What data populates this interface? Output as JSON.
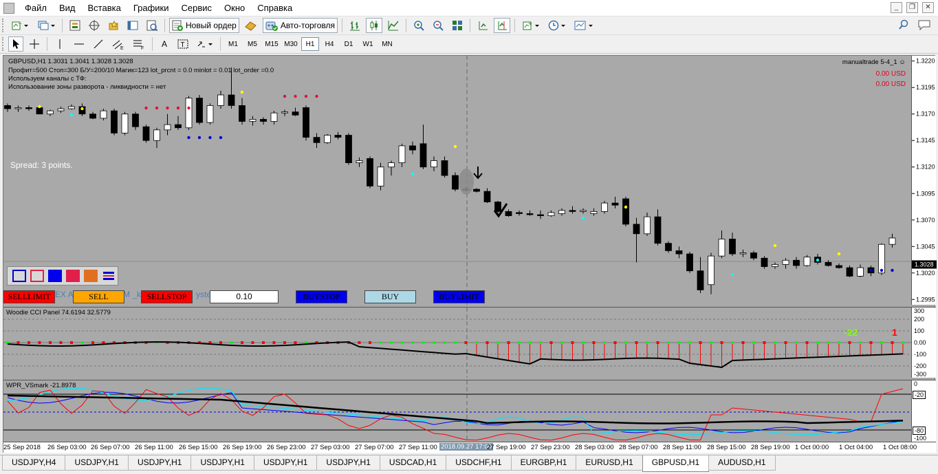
{
  "menu": {
    "items": [
      "Файл",
      "Вид",
      "Вставка",
      "Графики",
      "Сервис",
      "Окно",
      "Справка"
    ]
  },
  "toolbar": {
    "new_order": "Новый ордер",
    "autotrade": "Авто-торговля",
    "timeframes": [
      "M1",
      "M5",
      "M15",
      "M30",
      "H1",
      "H4",
      "D1",
      "W1",
      "MN"
    ],
    "active_timeframe": "H1"
  },
  "chart": {
    "header": "GBPUSD,H1  1.3031 1.3041 1.3028 1.3028",
    "info_lines": [
      "Профит=500  Стоп=300  Б/У=200/10  Магик=123 lot_prcnt = 0.0 minlot = 0.01 lot_order =0.0",
      "Используем каналы с ТФ:",
      "Использование зоны разворота - ликвидности = нет"
    ],
    "spread": "Spread: 3 points.",
    "account": "manualtrade 5-4_1",
    "pnl": [
      "0.00 USD",
      "0.00 USD"
    ],
    "price_labels": [
      "1.3220",
      "1.3195",
      "1.3170",
      "1.3145",
      "1.3120",
      "1.3095",
      "1.3070",
      "1.3045",
      "1.3020",
      "1.2995"
    ],
    "current_price": "1.3028",
    "palette_colors": [
      "#0000cc",
      "#e0204a",
      "#0000ee",
      "#e0204a",
      "#e07020",
      "#0000cc"
    ],
    "order_buttons": {
      "selllimit": "SELLLIMIT",
      "sell": "SELL",
      "sellstop": "SELLSTOP",
      "lot": "0.10",
      "buystop": "BUYSTOP",
      "buy": "BUY",
      "buylimit": "BUYLIMIT"
    },
    "bg_fragments": [
      "EX Al",
      "M _k",
      "yster"
    ],
    "colors": {
      "bg": "#a9a9a9",
      "bear": "#000000",
      "bull": "#ffffff",
      "sell_dot": "#dc143c",
      "buy_dot": "#0000cd"
    }
  },
  "cci": {
    "title": "Woodie CCI Panel 74.6194 32.5779",
    "scale": [
      "300",
      "200",
      "100",
      "0.00",
      "-100",
      "-200",
      "-300"
    ],
    "value_left": "-22",
    "value_right": "1"
  },
  "wpr": {
    "title": "WPR_VSmark -21.8978",
    "scale": [
      "0",
      "-20",
      "-80",
      "-100"
    ]
  },
  "xaxis": {
    "labels": [
      "25 Sep 2018",
      "26 Sep 03:00",
      "26 Sep 07:00",
      "26 Sep 11:00",
      "26 Sep 15:00",
      "26 Sep 19:00",
      "26 Sep 23:00",
      "27 Sep 03:00",
      "27 Sep 07:00",
      "27 Sep 11:00",
      "2018.09.27 17:00",
      "27 Sep 19:00",
      "27 Sep 23:00",
      "28 Sep 03:00",
      "28 Sep 07:00",
      "28 Sep 11:00",
      "28 Sep 15:00",
      "28 Sep 19:00",
      "1 Oct 00:00",
      "1 Oct 04:00",
      "1 Oct 08:00"
    ]
  },
  "tabs": [
    "USDJPY,H4",
    "USDJPY,H1",
    "USDJPY,H1",
    "USDJPY,H1",
    "USDJPY,H1",
    "USDJPY,H1",
    "USDCAD,H1",
    "USDCHF,H1",
    "EURGBP,H1",
    "EURUSD,H1",
    "GBPUSD,H1",
    "AUDUSD,H1"
  ],
  "active_tab": "GBPUSD,H1",
  "candles": [
    [
      1.3178,
      1.318,
      1.3172,
      1.3175
    ],
    [
      1.3175,
      1.3178,
      1.3172,
      1.3176
    ],
    [
      1.3176,
      1.3178,
      1.3173,
      1.3175
    ],
    [
      1.3176,
      1.3178,
      1.317,
      1.317
    ],
    [
      1.317,
      1.3174,
      1.3168,
      1.3173
    ],
    [
      1.3173,
      1.3177,
      1.3171,
      1.3175
    ],
    [
      1.3175,
      1.3179,
      1.3174,
      1.3177
    ],
    [
      1.3177,
      1.318,
      1.3168,
      1.317
    ],
    [
      1.317,
      1.3172,
      1.3165,
      1.3166
    ],
    [
      1.3166,
      1.3175,
      1.3164,
      1.3173
    ],
    [
      1.3173,
      1.3175,
      1.315,
      1.3152
    ],
    [
      1.3152,
      1.3172,
      1.315,
      1.317
    ],
    [
      1.317,
      1.3172,
      1.3155,
      1.3158
    ],
    [
      1.3158,
      1.316,
      1.3143,
      1.3145
    ],
    [
      1.3145,
      1.3157,
      1.3138,
      1.3155
    ],
    [
      1.3155,
      1.317,
      1.315,
      1.316
    ],
    [
      1.316,
      1.3168,
      1.3155,
      1.3157
    ],
    [
      1.3157,
      1.3187,
      1.3155,
      1.3185
    ],
    [
      1.3185,
      1.3188,
      1.316,
      1.3162
    ],
    [
      1.3162,
      1.318,
      1.316,
      1.3178
    ],
    [
      1.3178,
      1.3192,
      1.3175,
      1.3188
    ],
    [
      1.3188,
      1.3214,
      1.3175,
      1.3178
    ],
    [
      1.3178,
      1.3185,
      1.316,
      1.3163
    ],
    [
      1.3163,
      1.3168,
      1.3159,
      1.3165
    ],
    [
      1.3165,
      1.3167,
      1.316,
      1.3163
    ],
    [
      1.3163,
      1.3173,
      1.316,
      1.3171
    ],
    [
      1.3171,
      1.3174,
      1.3168,
      1.3172
    ],
    [
      1.3172,
      1.3176,
      1.3168,
      1.3169
    ],
    [
      1.3176,
      1.3178,
      1.3145,
      1.3148
    ],
    [
      1.3148,
      1.3152,
      1.3138,
      1.3143
    ],
    [
      1.3143,
      1.3151,
      1.3142,
      1.315
    ],
    [
      1.315,
      1.3153,
      1.3146,
      1.3148
    ],
    [
      1.315,
      1.3152,
      1.3122,
      1.3124
    ],
    [
      1.3124,
      1.3129,
      1.312,
      1.3126
    ],
    [
      1.3128,
      1.313,
      1.31,
      1.3102
    ],
    [
      1.3102,
      1.3124,
      1.3098,
      1.312
    ],
    [
      1.312,
      1.3126,
      1.3112,
      1.3124
    ],
    [
      1.3124,
      1.3142,
      1.312,
      1.314
    ],
    [
      1.314,
      1.3144,
      1.3132,
      1.3136
    ],
    [
      1.3142,
      1.316,
      1.3118,
      1.312
    ],
    [
      1.312,
      1.313,
      1.3116,
      1.3126
    ],
    [
      1.3126,
      1.313,
      1.311,
      1.3112
    ],
    [
      1.3112,
      1.3115,
      1.3097,
      1.3099
    ],
    [
      1.3099,
      1.3101,
      1.3097,
      1.3099
    ],
    [
      1.3099,
      1.31,
      1.3096,
      1.3097
    ],
    [
      1.3097,
      1.31,
      1.3086,
      1.3087
    ],
    [
      1.3087,
      1.3088,
      1.3076,
      1.3078
    ],
    [
      1.3078,
      1.308,
      1.3073,
      1.3074
    ],
    [
      1.3077,
      1.3079,
      1.3074,
      1.3076
    ],
    [
      1.3076,
      1.3079,
      1.3074,
      1.3075
    ],
    [
      1.3075,
      1.3079,
      1.3071,
      1.3074
    ],
    [
      1.3074,
      1.3079,
      1.3073,
      1.3077
    ],
    [
      1.3076,
      1.3081,
      1.3074,
      1.3079
    ],
    [
      1.3079,
      1.3083,
      1.3076,
      1.3078
    ],
    [
      1.3078,
      1.3081,
      1.3076,
      1.3079
    ],
    [
      1.3076,
      1.3081,
      1.3074,
      1.3078
    ],
    [
      1.3078,
      1.3088,
      1.3076,
      1.3086
    ],
    [
      1.3086,
      1.3092,
      1.3081,
      1.3084
    ],
    [
      1.309,
      1.3092,
      1.3064,
      1.3066
    ],
    [
      1.3066,
      1.3072,
      1.303,
      1.3057
    ],
    [
      1.3057,
      1.3077,
      1.3055,
      1.3073
    ],
    [
      1.3073,
      1.308,
      1.3046,
      1.3048
    ],
    [
      1.3048,
      1.305,
      1.3039,
      1.3041
    ],
    [
      1.3041,
      1.3045,
      1.3034,
      1.3038
    ],
    [
      1.3038,
      1.304,
      1.302,
      1.3022
    ],
    [
      1.3022,
      1.3035,
      1.3001,
      1.3004
    ],
    [
      1.3009,
      1.3039,
      1.3,
      1.3036
    ],
    [
      1.3036,
      1.306,
      1.3034,
      1.3052
    ],
    [
      1.3052,
      1.3058,
      1.3036,
      1.3038
    ],
    [
      1.3038,
      1.3042,
      1.3035,
      1.3039
    ],
    [
      1.3039,
      1.3041,
      1.3032,
      1.3034
    ],
    [
      1.3034,
      1.3036,
      1.3024,
      1.3026
    ],
    [
      1.3026,
      1.303,
      1.3024,
      1.3028
    ],
    [
      1.3028,
      1.3034,
      1.3024,
      1.3032
    ],
    [
      1.3032,
      1.3035,
      1.3024,
      1.3027
    ],
    [
      1.3027,
      1.3037,
      1.3026,
      1.3035
    ],
    [
      1.3035,
      1.3038,
      1.3028,
      1.303
    ],
    [
      1.303,
      1.3032,
      1.3026,
      1.3027
    ],
    [
      1.3027,
      1.3029,
      1.3024,
      1.3025
    ],
    [
      1.3025,
      1.3027,
      1.3016,
      1.3017
    ],
    [
      1.3017,
      1.3028,
      1.3016,
      1.3025
    ],
    [
      1.3025,
      1.3027,
      1.3017,
      1.302
    ],
    [
      1.302,
      1.3048,
      1.3018,
      1.3047
    ],
    [
      1.3047,
      1.3057,
      1.3044,
      1.3053
    ]
  ]
}
